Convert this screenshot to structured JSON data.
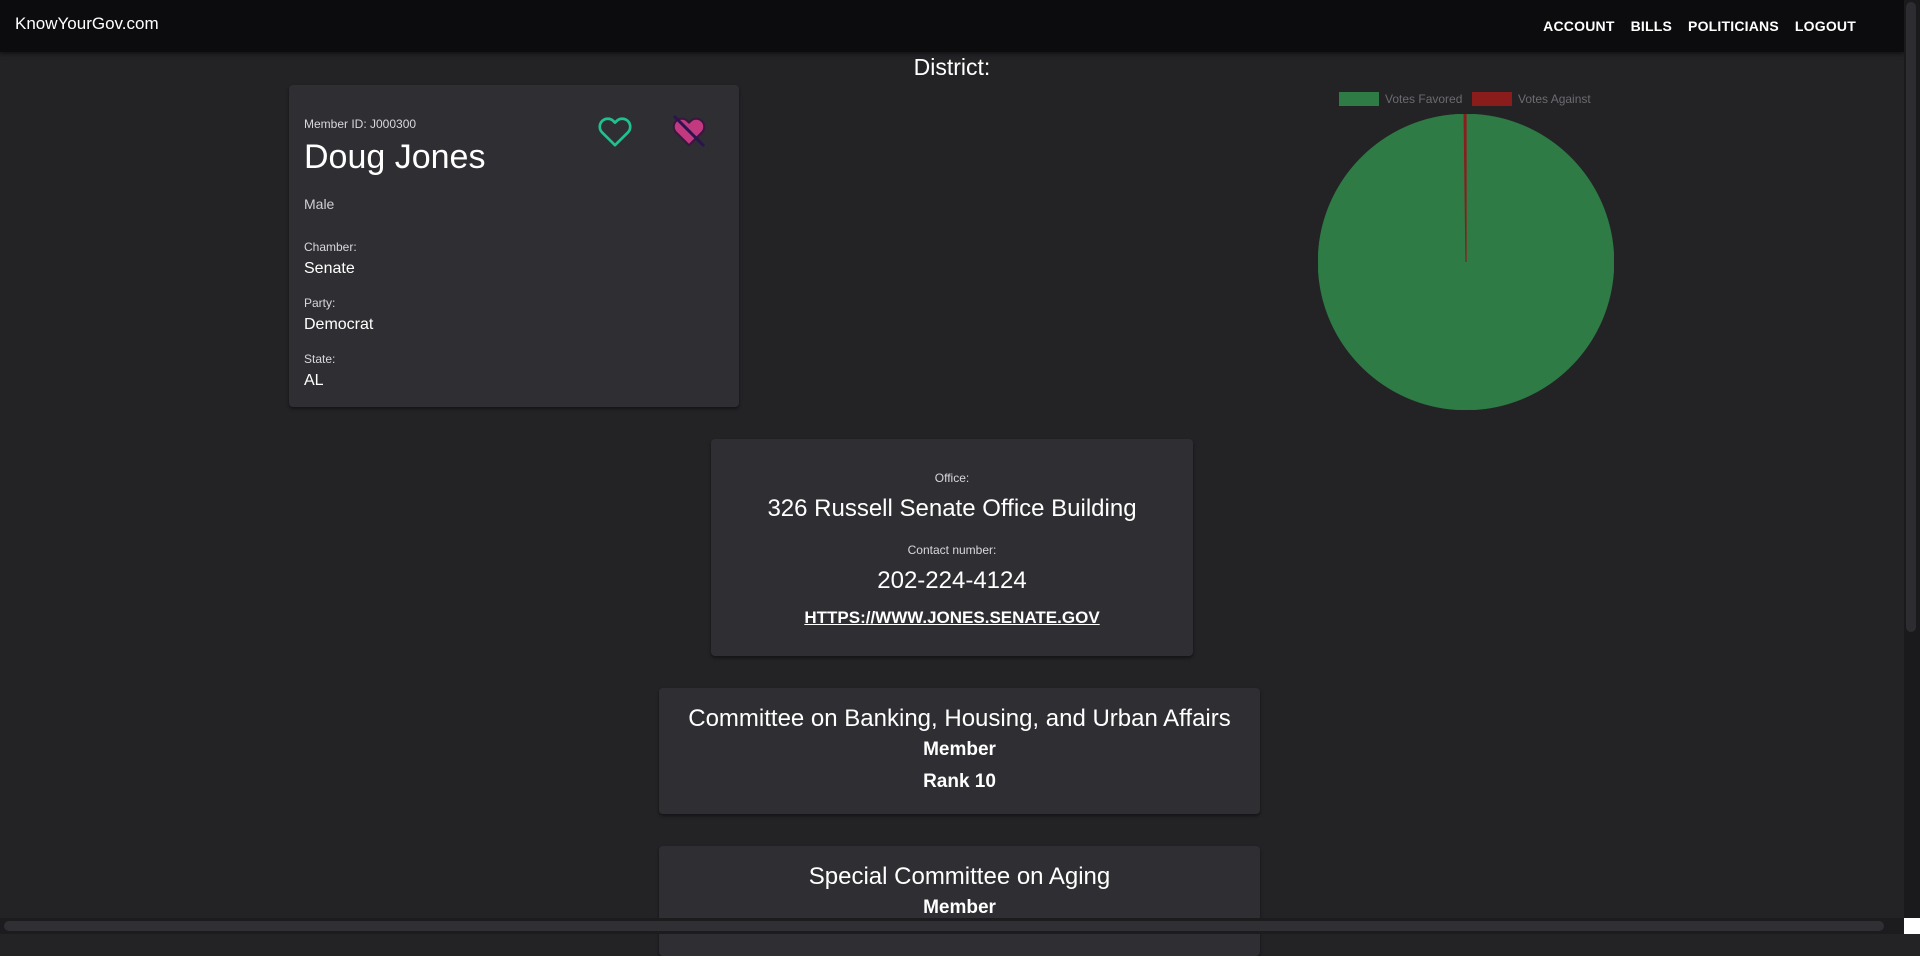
{
  "header": {
    "brand": "KnowYourGov.com",
    "nav": [
      "ACCOUNT",
      "BILLS",
      "POLITICIANS",
      "LOGOUT"
    ]
  },
  "district_label": "District:",
  "profile": {
    "member_id": "Member ID: J000300",
    "name": "Doug Jones",
    "gender": "Male",
    "chamber_label": "Chamber:",
    "chamber": "Senate",
    "party_label": "Party:",
    "party": "Democrat",
    "state_label": "State:",
    "state": "AL",
    "icons": [
      "heart-outline-icon",
      "heart-broken-icon"
    ]
  },
  "chart_data": {
    "type": "pie",
    "labels": [
      "Votes Favored",
      "Votes Against"
    ],
    "values": [
      99.8,
      0.2
    ],
    "colors": [
      "#2e7b45",
      "#8b1c1c"
    ],
    "legend_position": "top"
  },
  "office": {
    "office_label": "Office:",
    "office": "326 Russell Senate Office Building",
    "contact_label": "Contact number:",
    "phone": "202-224-4124",
    "url": "https://www.jones.senate.gov"
  },
  "committees": [
    {
      "name": "Committee on Banking, Housing, and Urban Affairs",
      "role": "Member",
      "rank": "Rank 10"
    },
    {
      "name": "Special Committee on Aging",
      "role": "Member",
      "rank": ""
    }
  ],
  "colors": {
    "background": "#232326",
    "card": "#2e2e33",
    "appbar": "#0c0c0e",
    "favorite": "#1fc18f",
    "unfavorite": "#c2397f"
  }
}
